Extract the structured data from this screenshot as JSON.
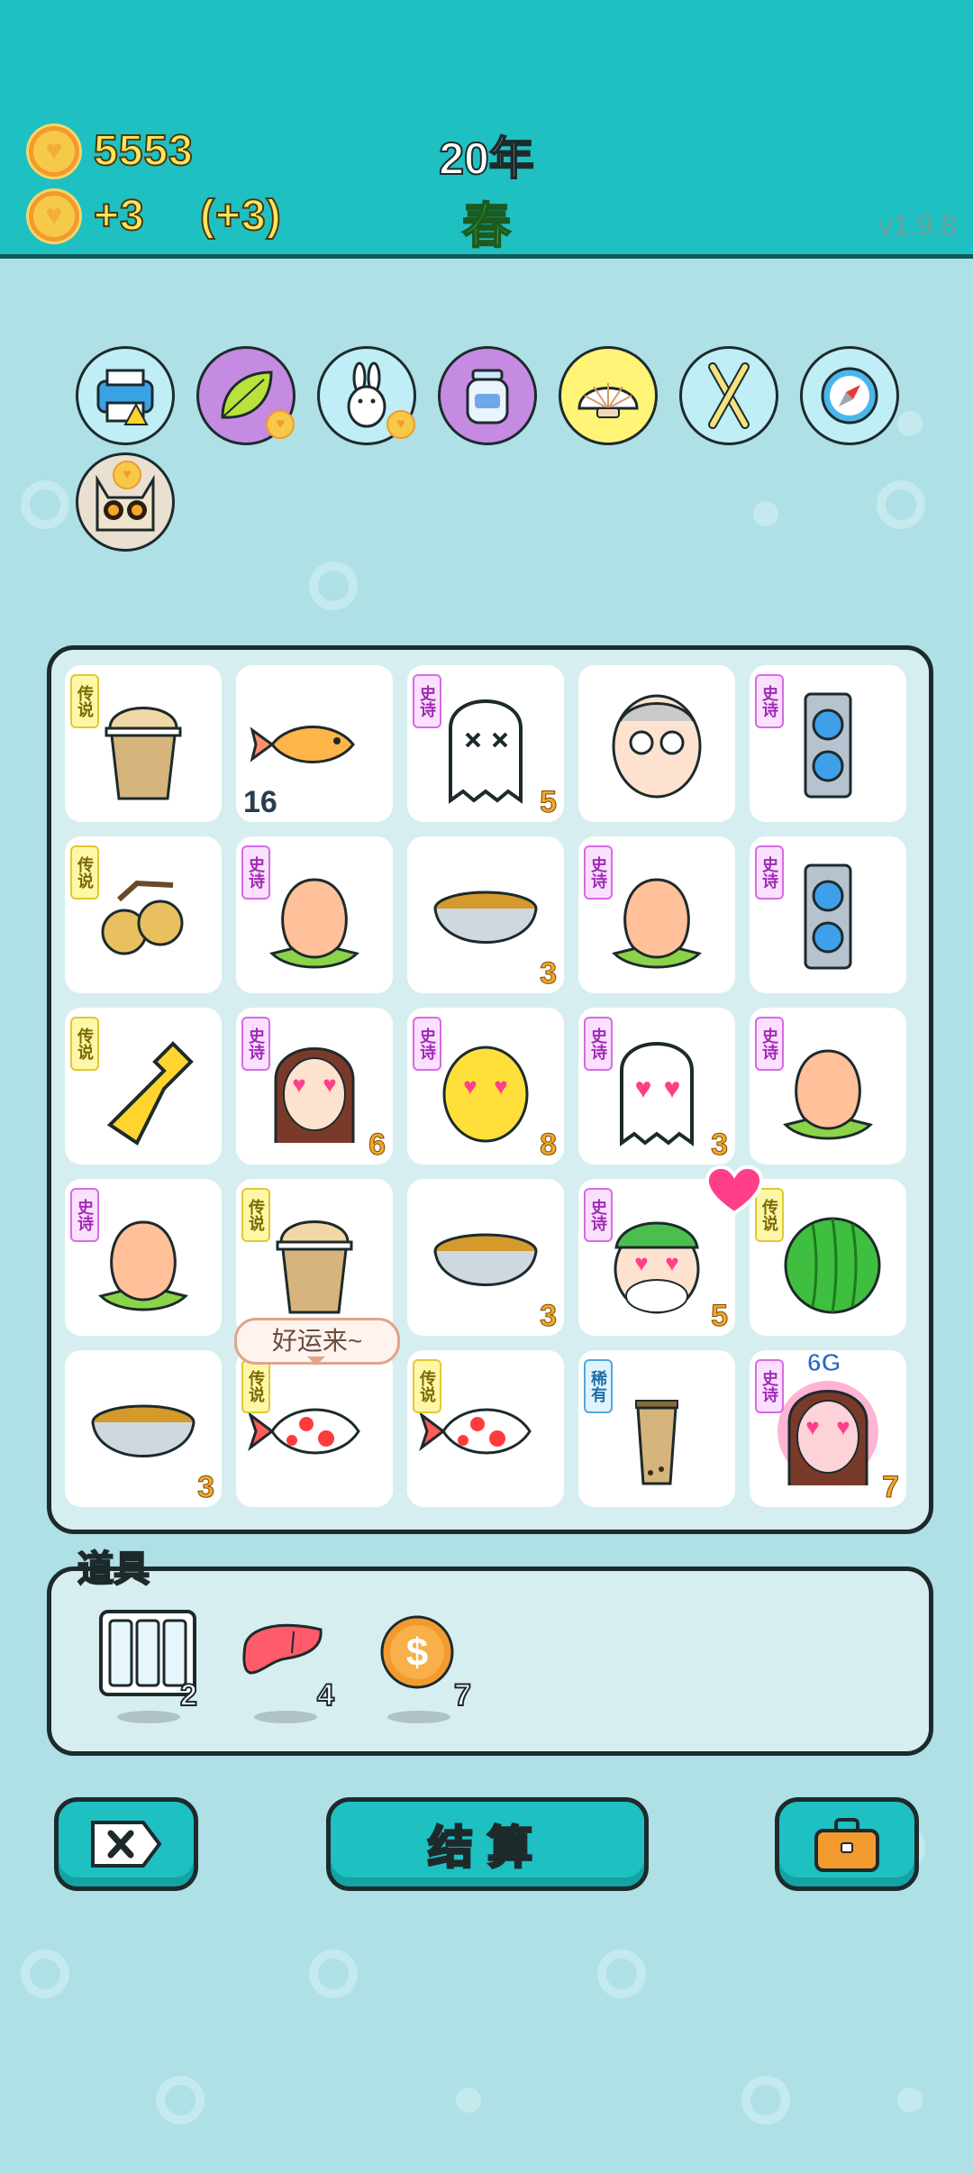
{
  "header": {
    "coins": "5553",
    "income": "+3",
    "income_bonus": "(+3)",
    "year": "20年",
    "season": "春",
    "version": "v1.9.8"
  },
  "relics": [
    {
      "name": "printer"
    },
    {
      "name": "leaf"
    },
    {
      "name": "rabbit"
    },
    {
      "name": "jar"
    },
    {
      "name": "shell"
    },
    {
      "name": "chopsticks"
    },
    {
      "name": "compass"
    },
    {
      "name": "cat"
    }
  ],
  "tags": {
    "legend": "传说",
    "epic": "史诗",
    "rare": "稀有"
  },
  "board": {
    "cells": [
      {
        "item": "milk-tea-cup",
        "tag": "legend",
        "count": ""
      },
      {
        "item": "goldfish",
        "tag": "",
        "count": "16"
      },
      {
        "item": "ghost-dead",
        "tag": "epic",
        "count": "5"
      },
      {
        "item": "grandpa",
        "tag": "",
        "count": ""
      },
      {
        "item": "gpu",
        "tag": "epic",
        "count": ""
      },
      {
        "item": "longan",
        "tag": "legend",
        "count": ""
      },
      {
        "item": "peach",
        "tag": "epic",
        "count": ""
      },
      {
        "item": "soup-bowl",
        "tag": "",
        "count": "3"
      },
      {
        "item": "peach",
        "tag": "epic",
        "count": ""
      },
      {
        "item": "gpu",
        "tag": "epic",
        "count": ""
      },
      {
        "item": "pointing-hand",
        "tag": "legend",
        "count": ""
      },
      {
        "item": "girl-heart-eyes",
        "tag": "epic",
        "count": "6"
      },
      {
        "item": "chick-heart-eyes",
        "tag": "epic",
        "count": "8"
      },
      {
        "item": "ghost-heart-eyes",
        "tag": "epic",
        "count": "3"
      },
      {
        "item": "peach",
        "tag": "epic",
        "count": ""
      },
      {
        "item": "peach",
        "tag": "epic",
        "count": ""
      },
      {
        "item": "milk-tea-cup",
        "tag": "legend",
        "count": ""
      },
      {
        "item": "soup-bowl",
        "tag": "",
        "count": "3"
      },
      {
        "item": "old-man-heart-eyes",
        "tag": "epic",
        "count": "5"
      },
      {
        "item": "watermelon",
        "tag": "legend",
        "count": ""
      },
      {
        "item": "soup-bowl",
        "tag": "",
        "count": "3"
      },
      {
        "item": "koi",
        "tag": "legend",
        "count": ""
      },
      {
        "item": "koi",
        "tag": "legend",
        "count": ""
      },
      {
        "item": "boba-tea",
        "tag": "rare",
        "count": ""
      },
      {
        "item": "girl-heart-eyes-glow",
        "tag": "epic",
        "count": "7"
      }
    ],
    "bubble": "好运来~",
    "overlay_label": "6G"
  },
  "props": {
    "title": "道具",
    "items": [
      {
        "name": "glass-cases",
        "count": "2"
      },
      {
        "name": "liver",
        "count": "4"
      },
      {
        "name": "dollar-coin",
        "count": "7"
      }
    ]
  },
  "buttons": {
    "settle": "结算"
  },
  "colors": {
    "header": "#1fc0c1",
    "background": "#aee0e6",
    "coin_text": "#ffe55c",
    "season": "#3bd651"
  }
}
